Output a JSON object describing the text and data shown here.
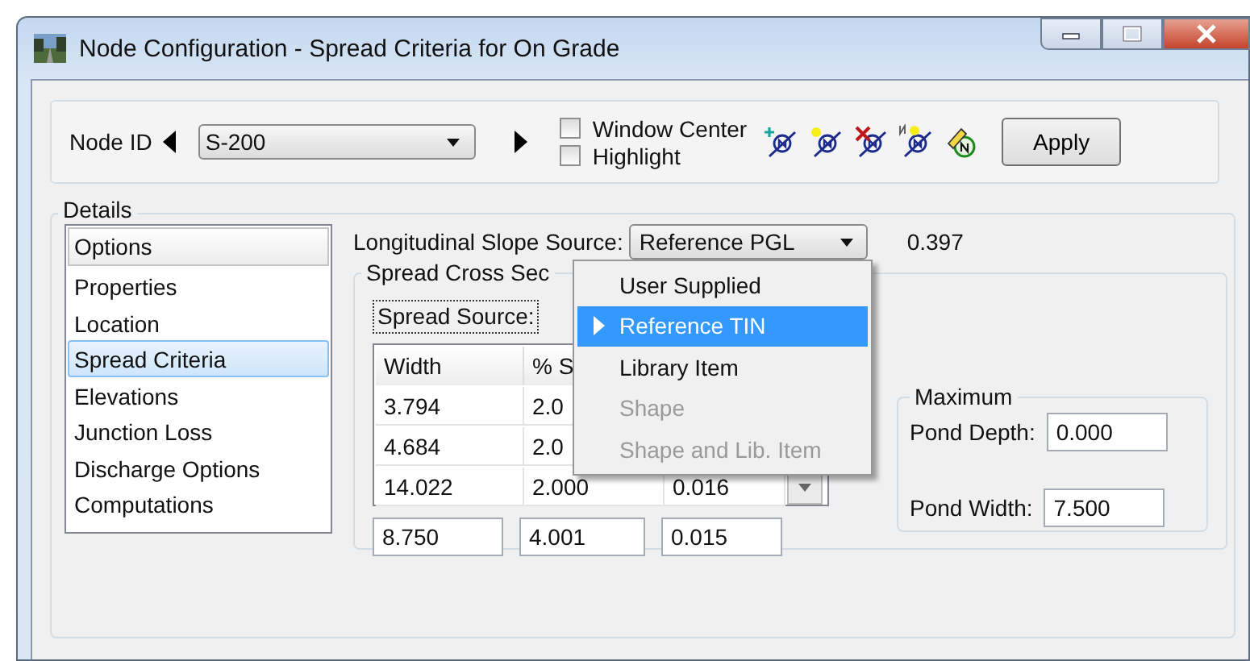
{
  "window": {
    "title": "Node Configuration - Spread Criteria for On Grade"
  },
  "toolbar": {
    "node_id_label": "Node ID",
    "node_id": "S-200",
    "checkboxes": [
      {
        "label": "Window Center",
        "checked": false
      },
      {
        "label": "Highlight",
        "checked": false
      }
    ],
    "apply": "Apply"
  },
  "details": {
    "title": "Details",
    "list_header": "Options",
    "items": [
      {
        "label": "Properties",
        "selected": false
      },
      {
        "label": "Location",
        "selected": false
      },
      {
        "label": "Spread Criteria",
        "selected": true
      },
      {
        "label": "Elevations",
        "selected": false
      },
      {
        "label": "Junction Loss",
        "selected": false
      },
      {
        "label": "Discharge Options",
        "selected": false
      },
      {
        "label": "Computations",
        "selected": false
      }
    ]
  },
  "slope": {
    "label": "Longitudinal Slope Source:",
    "value": "Reference PGL",
    "reading": "0.397"
  },
  "cross_section": {
    "title": "Spread Cross Sec",
    "source_label": "Spread Source:",
    "columns": [
      "Width",
      "% S"
    ],
    "rows": [
      [
        "3.794",
        "2.0"
      ],
      [
        "4.684",
        "2.0"
      ],
      [
        "14.022",
        "2.000",
        "0.016"
      ]
    ],
    "totals": [
      "8.750",
      "4.001",
      "0.015"
    ]
  },
  "maximum": {
    "title": "Maximum",
    "fields": [
      {
        "label": "Pond Depth:",
        "value": "0.000"
      },
      {
        "label": "Pond Width:",
        "value": "7.500"
      }
    ]
  },
  "menu": {
    "items": [
      {
        "label": "User Supplied",
        "selected": false,
        "disabled": false
      },
      {
        "label": "Reference TIN",
        "selected": true,
        "disabled": false
      },
      {
        "label": "Library Item",
        "selected": false,
        "disabled": false
      },
      {
        "label": "Shape",
        "selected": false,
        "disabled": true
      },
      {
        "label": "Shape and Lib. Item",
        "selected": false,
        "disabled": true
      }
    ]
  }
}
